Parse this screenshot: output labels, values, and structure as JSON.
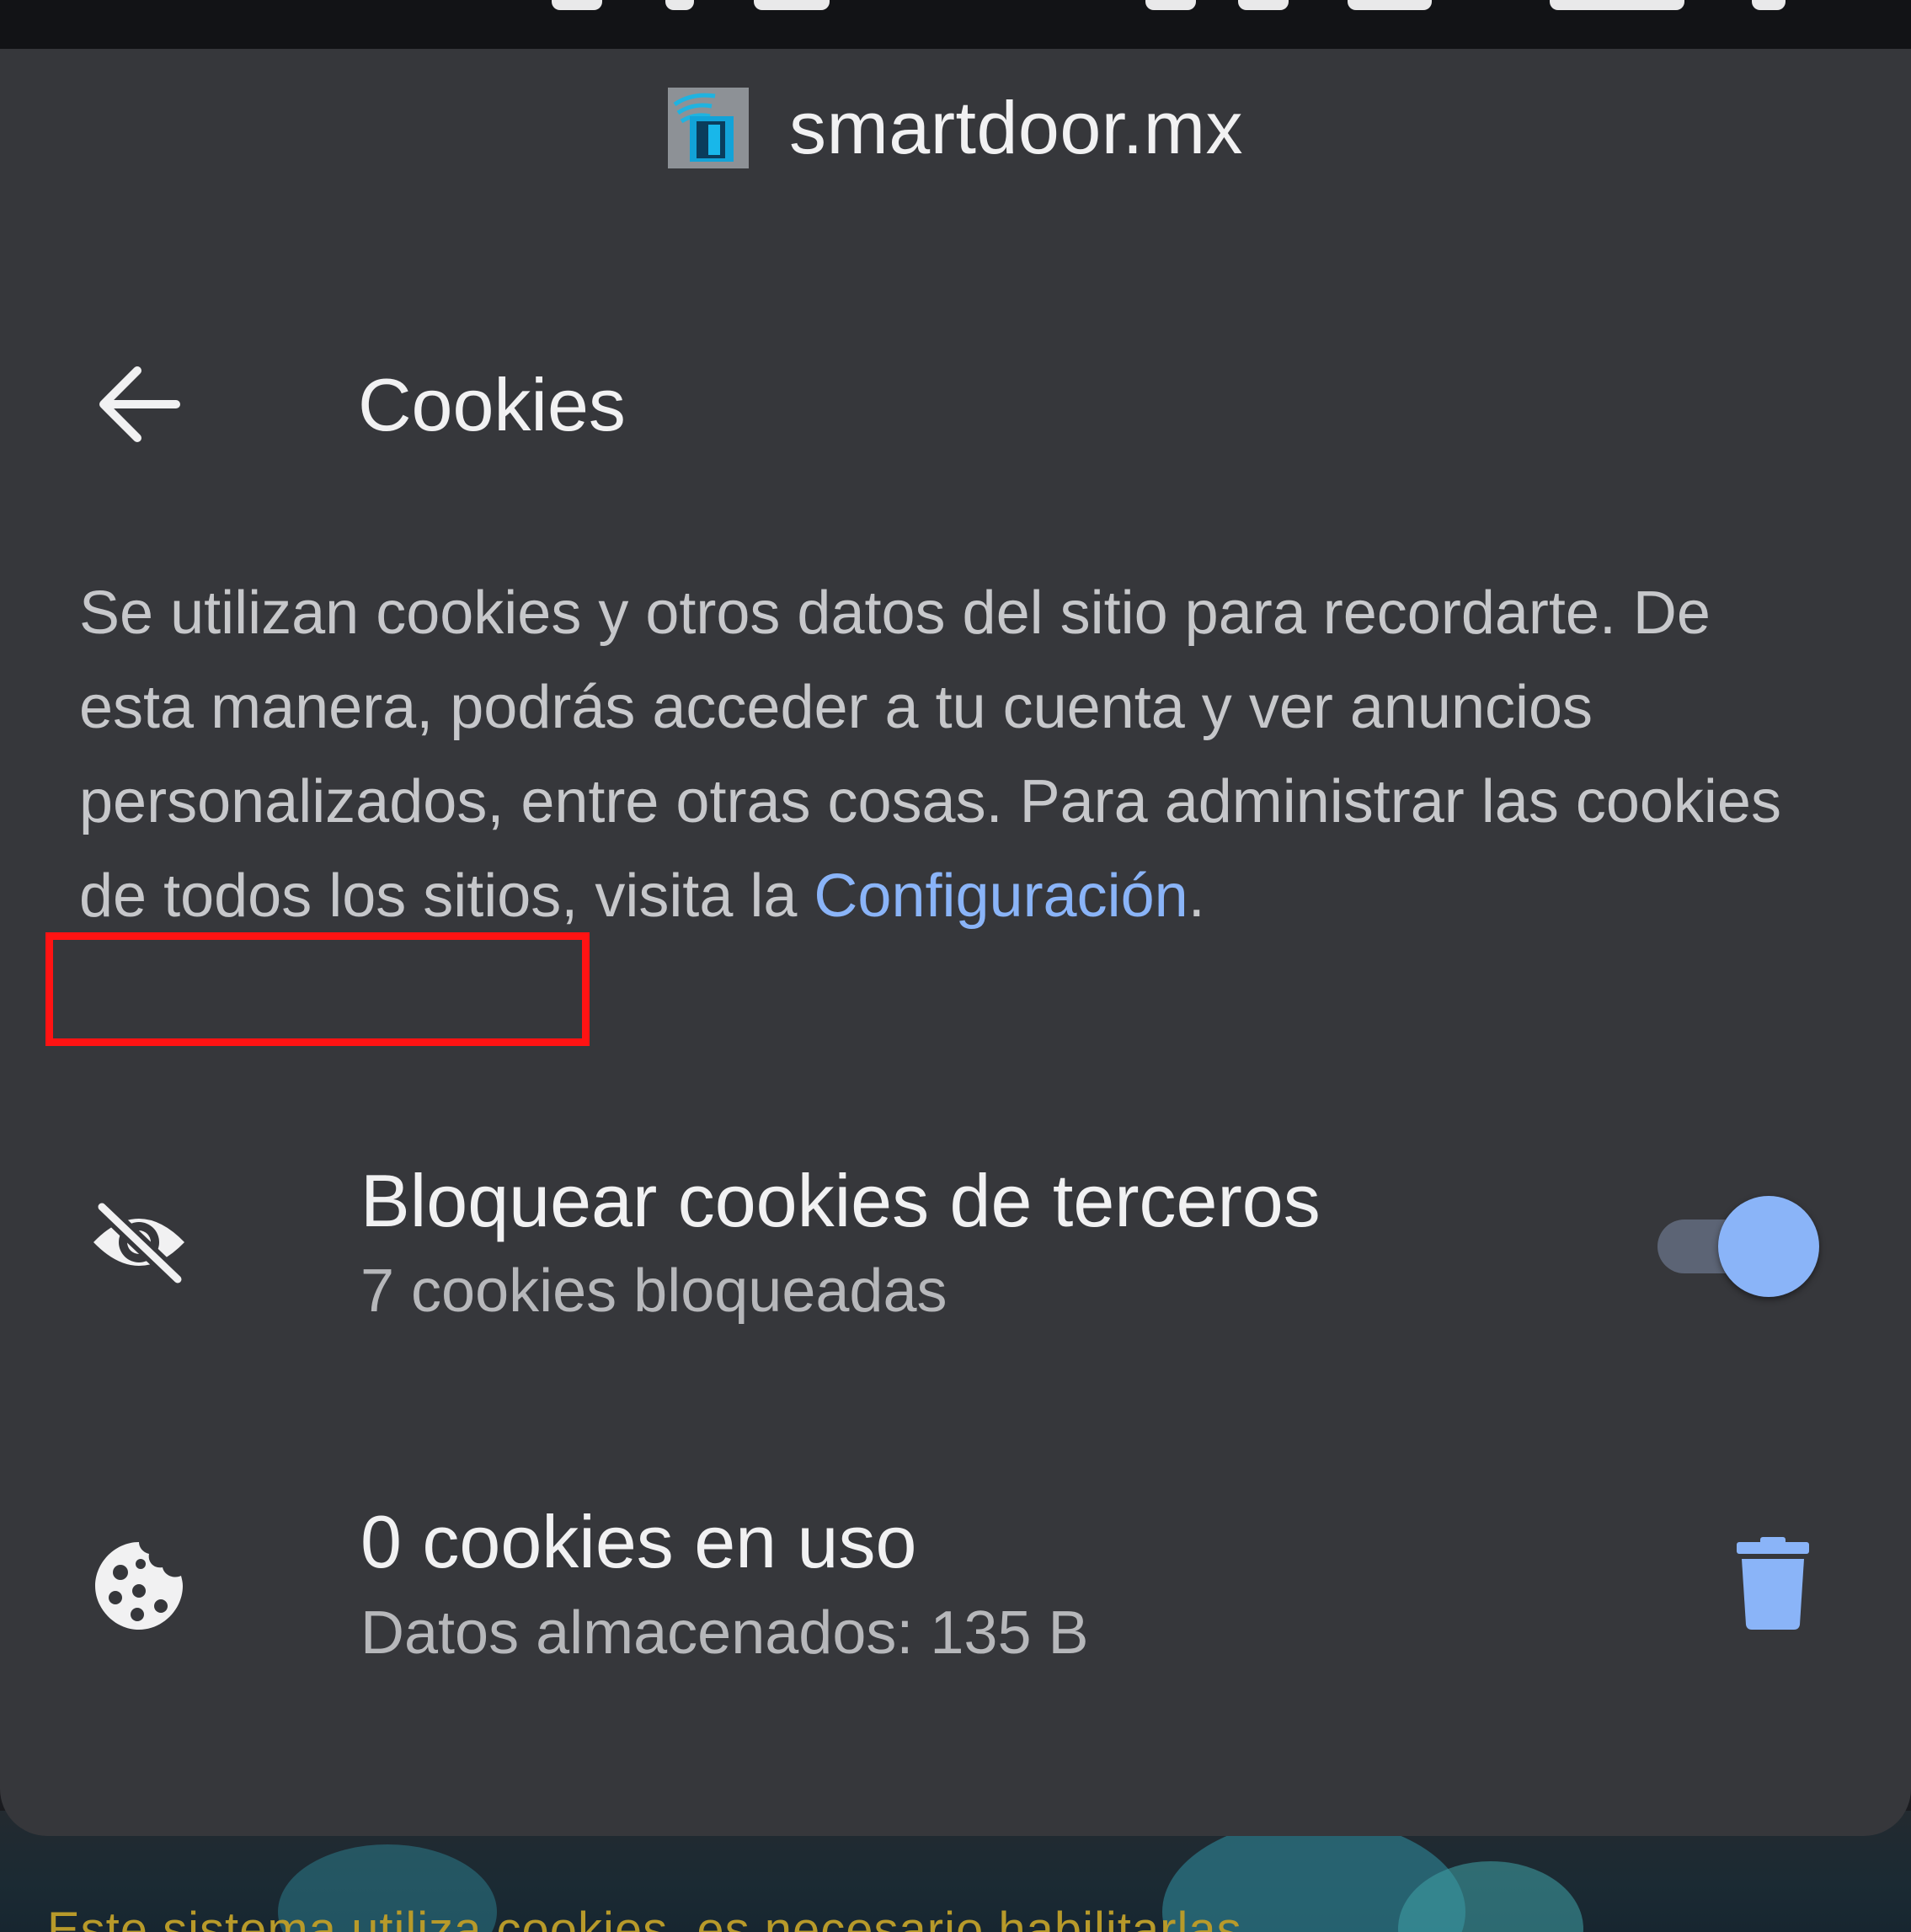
{
  "site": {
    "name": "smartdoor.mx",
    "favicon_icon": "smartdoor-logo-icon"
  },
  "page": {
    "title": "Cookies",
    "back_icon": "arrow-back-icon"
  },
  "description": {
    "text": "Se utilizan cookies y otros datos del sitio para recordarte. De esta manera, podrás acceder a tu cuenta y ver anuncios personalizados, entre otras cosas. Para administrar las cookies de todos los sitios, visita la ",
    "link_text": "Configuración",
    "after_link": "."
  },
  "third_party": {
    "title": "Bloquear cookies de terceros",
    "subtitle": "7 cookies bloqueadas",
    "enabled": true,
    "icon": "eye-off-icon"
  },
  "cookies_in_use": {
    "title": "0 cookies en uso",
    "subtitle": "Datos almacenados: 135 B",
    "icon": "cookie-icon",
    "action_icon": "trash-icon"
  },
  "background_page": {
    "text": "Este sistema utiliza cookies, es necesario habilitarlas"
  },
  "colors": {
    "sheet_bg": "#36373b",
    "accent": "#8ab4f8",
    "highlight": "#ff1313",
    "background_text": "#b89a2a"
  }
}
